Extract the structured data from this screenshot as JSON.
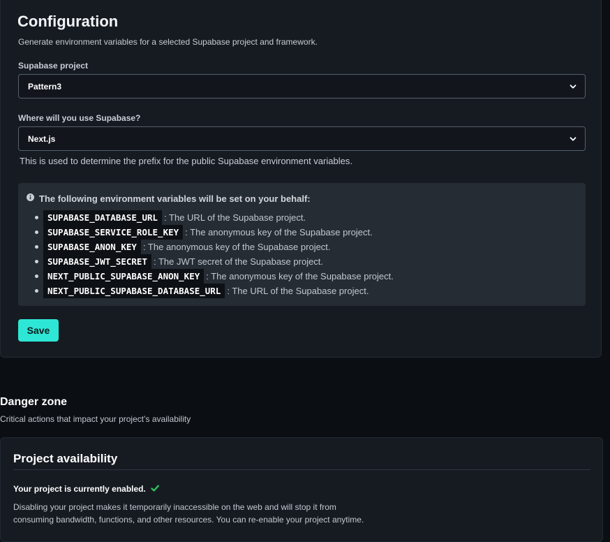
{
  "configuration": {
    "title": "Configuration",
    "subtitle": "Generate environment variables for a selected Supabase project and framework.",
    "project_label": "Supabase project",
    "project_value": "Pattern3",
    "framework_label": "Where will you use Supabase?",
    "framework_value": "Next.js",
    "helper_text": "This is used to determine the prefix for the public Supabase environment variables.",
    "info_title": "The following environment variables will be set on your behalf:",
    "env_vars": [
      {
        "name": "SUPABASE_DATABASE_URL",
        "desc": ": The URL of the Supabase project."
      },
      {
        "name": "SUPABASE_SERVICE_ROLE_KEY",
        "desc": ": The anonymous key of the Supabase project."
      },
      {
        "name": "SUPABASE_ANON_KEY",
        "desc": ": The anonymous key of the Supabase project."
      },
      {
        "name": "SUPABASE_JWT_SECRET",
        "desc": ": The JWT secret of the Supabase project."
      },
      {
        "name": "NEXT_PUBLIC_SUPABASE_ANON_KEY",
        "desc": ": The anonymous key of the Supabase project."
      },
      {
        "name": "NEXT_PUBLIC_SUPABASE_DATABASE_URL",
        "desc": ": The URL of the Supabase project."
      }
    ],
    "save_label": "Save"
  },
  "danger_zone": {
    "title": "Danger zone",
    "subtitle": "Critical actions that impact your project’s availability"
  },
  "availability": {
    "title": "Project availability",
    "status": "Your project is currently enabled.",
    "description": "Disabling your project makes it temporarily inaccessible on the web and will stop it from consuming bandwidth, functions, and other resources. You can re-enable your project anytime."
  },
  "icons": {
    "select_arrow": "chevron-down-icon",
    "info": "info-icon",
    "status": "check-icon"
  },
  "colors": {
    "accent": "#2ee6d6",
    "success": "#2fbf5a",
    "background": "#0b0f14",
    "card": "#161b22"
  }
}
